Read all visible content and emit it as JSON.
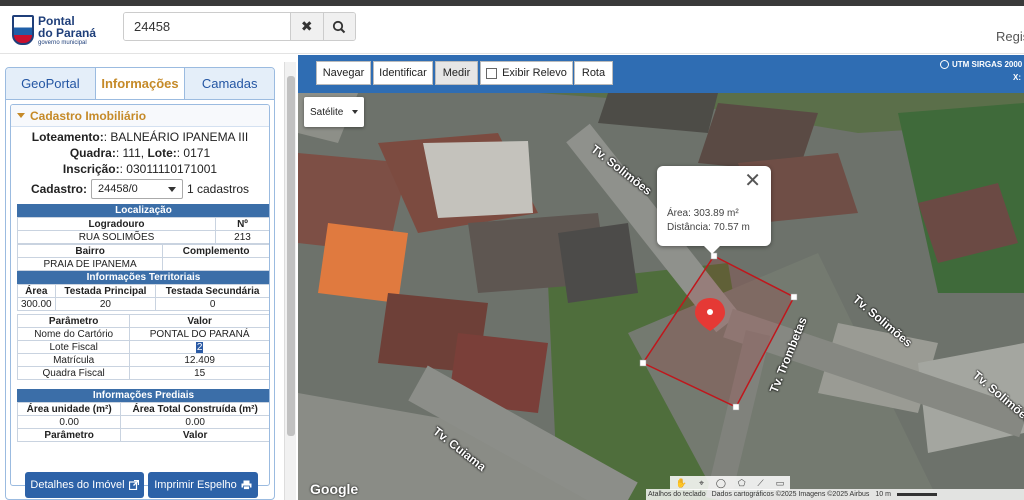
{
  "header": {
    "logo_line1": "Pontal",
    "logo_line2": "do Paraná",
    "logo_line3": "governo municipal",
    "search_value": "24458",
    "clear_icon": "✖",
    "search_icon": "🔍",
    "register_text": "Regis"
  },
  "tabs": [
    {
      "label": "GeoPortal"
    },
    {
      "label": "Informações"
    },
    {
      "label": "Camadas"
    }
  ],
  "cadastro": {
    "title": "Cadastro Imobiliário",
    "loteamento_label": "Loteamento:",
    "loteamento_value": ": BALNEÁRIO IPANEMA III",
    "quadra_label": "Quadra:",
    "quadra_value": ": 111, ",
    "lote_label": "Lote:",
    "lote_value": ": 0171",
    "inscricao_label": "Inscrição:",
    "inscricao_value": ": 03011110171001",
    "cadastro_label": "Cadastro:",
    "cadastro_value": "24458/0",
    "cadastro_count": "1 cadastros"
  },
  "localizacao": {
    "title": "Localização",
    "col_logradouro": "Logradouro",
    "col_numero": "Nº",
    "logradouro": "RUA SOLIMÕES",
    "numero": "213",
    "col_bairro": "Bairro",
    "col_complemento": "Complemento",
    "bairro": "PRAIA DE IPANEMA",
    "complemento": ""
  },
  "territoriais": {
    "title": "Informações Territoriais",
    "col_area": "Área",
    "col_testada_principal": "Testada Principal",
    "col_testada_secundaria": "Testada Secundária",
    "area": "300.00",
    "testada_principal": "20",
    "testada_secundaria": "0",
    "col_parametro": "Parâmetro",
    "col_valor": "Valor",
    "rows": [
      {
        "param": "Nome do Cartório",
        "value": "PONTAL DO PARANÁ"
      },
      {
        "param": "Lote Fiscal",
        "value": "2"
      },
      {
        "param": "Matrícula",
        "value": "12.409"
      },
      {
        "param": "Quadra Fiscal",
        "value": "15"
      }
    ]
  },
  "prediais": {
    "title": "Informações Prediais",
    "col_area_unidade": "Área unidade (m²)",
    "col_area_total": "Área Total Construída (m²)",
    "area_unidade": "0.00",
    "area_total": "0.00",
    "col_parametro": "Parâmetro",
    "col_valor": "Valor"
  },
  "buttons": {
    "detalhes": "Detalhes do Imóvel",
    "imprimir": "Imprimir Espelho"
  },
  "toolbar": {
    "navegar": "Navegar",
    "identificar": "Identificar",
    "medir": "Medir",
    "exibir_relevo": "Exibir Relevo",
    "rota": "Rota",
    "utm": "UTM SIRGAS 2000",
    "utm_x": "X:"
  },
  "map": {
    "layer_select": "Satélite",
    "popup_area": "Área: 303.89 m²",
    "popup_distance": "Distância: 70.57 m",
    "streets": [
      "Tv. Solimões",
      "Tv. Solimões",
      "Tv. Solimões",
      "Tv. Trombetas",
      "Tv. Cuiama"
    ],
    "google": "Google",
    "attrib_keys": "Atalhos do teclado",
    "attrib_data": "Dados cartográficos ©2025 Imagens ©2025 Airbus",
    "scale": "10 m",
    "colors": {
      "measure": "#c0171c",
      "pin": "#e53935",
      "accent": "#2f6db3"
    }
  }
}
